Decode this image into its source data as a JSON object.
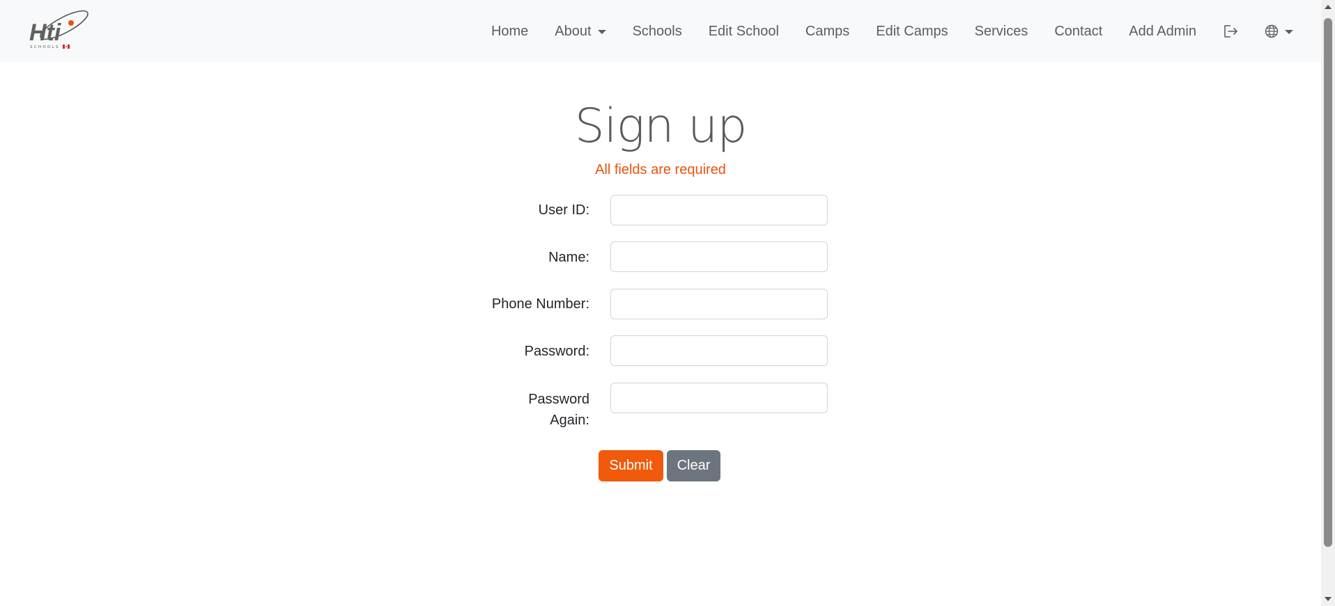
{
  "logo": {
    "alt_text": "Hti SCHOOLS"
  },
  "nav": {
    "items": [
      {
        "label": "Home"
      },
      {
        "label": "About"
      },
      {
        "label": "Schools"
      },
      {
        "label": "Edit School"
      },
      {
        "label": "Camps"
      },
      {
        "label": "Edit Camps"
      },
      {
        "label": "Services"
      },
      {
        "label": "Contact"
      },
      {
        "label": "Add Admin"
      }
    ],
    "logout_icon": "logout-icon",
    "language_icon": "globe-icon"
  },
  "form": {
    "title": "Sign up",
    "subtitle": "All fields are required",
    "fields": [
      {
        "label": "User ID:",
        "value": ""
      },
      {
        "label": "Name:",
        "value": ""
      },
      {
        "label": "Phone Number:",
        "value": ""
      },
      {
        "label": "Password:",
        "value": ""
      },
      {
        "label": "Password Again:",
        "value": ""
      }
    ],
    "submit_label": "Submit",
    "clear_label": "Clear"
  },
  "colors": {
    "accent": "#f05a0a",
    "secondary": "#6c757d",
    "navbar_bg": "#f8f9fa"
  }
}
